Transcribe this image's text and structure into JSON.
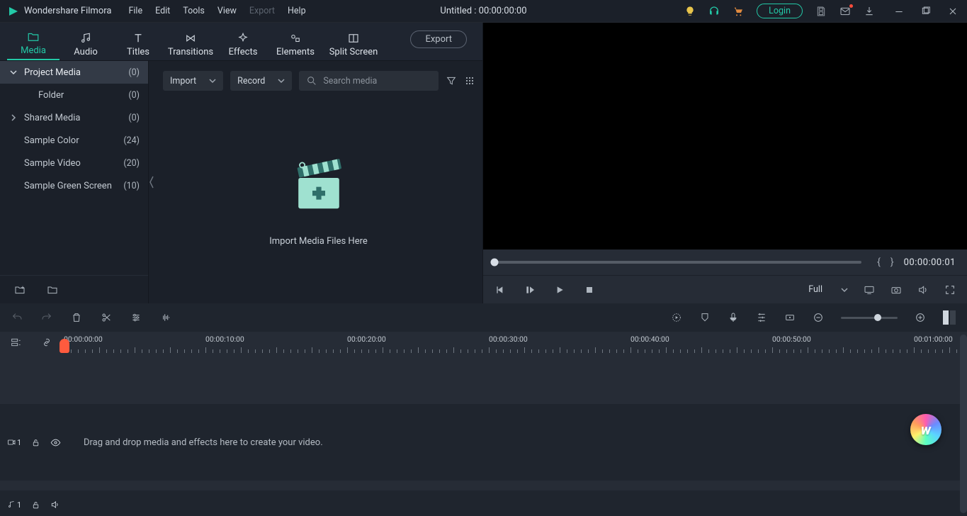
{
  "app": {
    "name": "Wondershare Filmora",
    "title": "Untitled : 00:00:00:00"
  },
  "menuBar": [
    "File",
    "Edit",
    "Tools",
    "View",
    "Export",
    "Help"
  ],
  "menuDisabled": [
    "Export"
  ],
  "login": "Login",
  "tabs": [
    "Media",
    "Audio",
    "Titles",
    "Transitions",
    "Effects",
    "Elements",
    "Split Screen"
  ],
  "exportBtn": "Export",
  "sidebar": [
    {
      "label": "Project Media",
      "count": "(0)",
      "chev": "down",
      "active": true
    },
    {
      "label": "Folder",
      "count": "(0)",
      "indent": true
    },
    {
      "label": "Shared Media",
      "count": "(0)",
      "chev": "right"
    },
    {
      "label": "Sample Color",
      "count": "(24)"
    },
    {
      "label": "Sample Video",
      "count": "(20)"
    },
    {
      "label": "Sample Green Screen",
      "count": "(10)"
    }
  ],
  "mediaTools": {
    "import": "Import",
    "record": "Record",
    "searchPlaceholder": "Search media"
  },
  "importHint": "Import Media Files Here",
  "preview": {
    "timecode": "00:00:00:01",
    "quality": "Full"
  },
  "ruler": [
    "00:00:00:00",
    "00:00:10:00",
    "00:00:20:00",
    "00:00:30:00",
    "00:00:40:00",
    "00:00:50:00",
    "00:01:00:00"
  ],
  "timelineHint": "Drag and drop media and effects here to create your video.",
  "tracks": {
    "video": "1",
    "audio": "1"
  }
}
